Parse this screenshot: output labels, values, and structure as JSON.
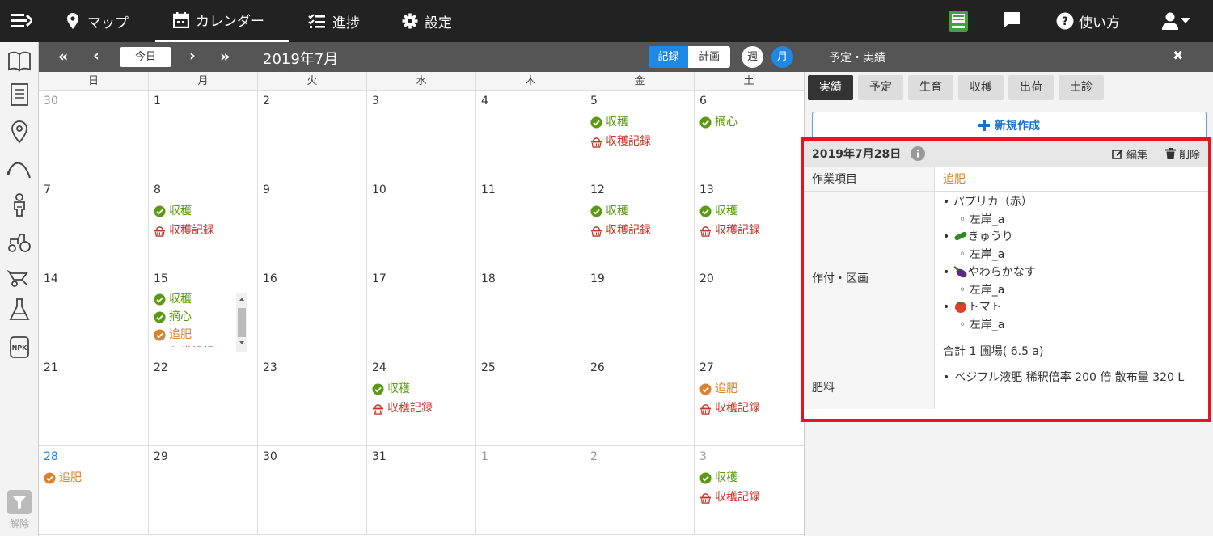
{
  "topbar": {
    "nav": [
      {
        "label": "マップ",
        "icon": "map-pin-icon"
      },
      {
        "label": "カレンダー",
        "icon": "calendar-icon"
      },
      {
        "label": "進捗",
        "icon": "checklist-icon"
      },
      {
        "label": "設定",
        "icon": "gear-icon"
      }
    ],
    "help_label": "使い方"
  },
  "subbar": {
    "today_label": "今日",
    "month_title": "2019年7月",
    "record_label": "記録",
    "plan_label": "計画",
    "week_label": "週",
    "month_label": "月",
    "panel_title": "予定・実績",
    "close_glyph": "✖"
  },
  "sidebar": {
    "filter_label": "解除"
  },
  "calendar": {
    "weekdays": [
      "日",
      "月",
      "火",
      "水",
      "木",
      "金",
      "土"
    ],
    "weeks": [
      [
        {
          "d": "30",
          "o": true,
          "e": []
        },
        {
          "d": "1",
          "e": []
        },
        {
          "d": "2",
          "e": []
        },
        {
          "d": "3",
          "e": []
        },
        {
          "d": "4",
          "e": []
        },
        {
          "d": "5",
          "e": [
            [
              "g",
              "収穫"
            ],
            [
              "r",
              "収穫記録"
            ]
          ]
        },
        {
          "d": "6",
          "e": [
            [
              "g",
              "摘心"
            ]
          ]
        }
      ],
      [
        {
          "d": "7",
          "e": []
        },
        {
          "d": "8",
          "e": [
            [
              "g",
              "収穫"
            ],
            [
              "r",
              "収穫記録"
            ]
          ]
        },
        {
          "d": "9",
          "e": []
        },
        {
          "d": "10",
          "e": []
        },
        {
          "d": "11",
          "e": []
        },
        {
          "d": "12",
          "e": [
            [
              "g",
              "収穫"
            ],
            [
              "r",
              "収穫記録"
            ]
          ]
        },
        {
          "d": "13",
          "e": [
            [
              "g",
              "収穫"
            ],
            [
              "r",
              "収穫記録"
            ]
          ]
        }
      ],
      [
        {
          "d": "14",
          "e": []
        },
        {
          "d": "15",
          "scroll": true,
          "e": [
            [
              "g",
              "収穫"
            ],
            [
              "g",
              "摘心"
            ],
            [
              "o",
              "追肥"
            ],
            [
              "r",
              "収穫記録"
            ]
          ]
        },
        {
          "d": "16",
          "e": []
        },
        {
          "d": "17",
          "e": []
        },
        {
          "d": "18",
          "e": []
        },
        {
          "d": "19",
          "e": []
        },
        {
          "d": "20",
          "e": []
        }
      ],
      [
        {
          "d": "21",
          "e": []
        },
        {
          "d": "22",
          "e": []
        },
        {
          "d": "23",
          "e": []
        },
        {
          "d": "24",
          "e": [
            [
              "g",
              "収穫"
            ],
            [
              "r",
              "収穫記録"
            ]
          ]
        },
        {
          "d": "25",
          "e": []
        },
        {
          "d": "26",
          "e": []
        },
        {
          "d": "27",
          "e": [
            [
              "o",
              "追肥"
            ],
            [
              "r",
              "収穫記録"
            ]
          ]
        }
      ],
      [
        {
          "d": "28",
          "t": true,
          "e": [
            [
              "o",
              "追肥"
            ]
          ]
        },
        {
          "d": "29",
          "e": []
        },
        {
          "d": "30",
          "e": []
        },
        {
          "d": "31",
          "e": []
        },
        {
          "d": "1",
          "o": true,
          "e": []
        },
        {
          "d": "2",
          "o": true,
          "e": []
        },
        {
          "d": "3",
          "o": true,
          "e": [
            [
              "g",
              "収穫"
            ],
            [
              "r",
              "収穫記録"
            ]
          ]
        }
      ]
    ]
  },
  "panel": {
    "tabs": [
      "実績",
      "予定",
      "生育",
      "収穫",
      "出荷",
      "土診"
    ],
    "new_label": "新規作成",
    "card": {
      "date": "2019年7月28日",
      "edit_label": "編集",
      "delete_label": "削除",
      "task_key": "作業項目",
      "task_value": "追肥",
      "crop_key": "作付・区画",
      "crops": [
        {
          "name": "パプリカ（赤）",
          "plot": "左岸_a",
          "icon": ""
        },
        {
          "name": "きゅうり",
          "plot": "左岸_a",
          "icon": "cucumber-icon"
        },
        {
          "name": "やわらかなす",
          "plot": "左岸_a",
          "icon": "eggplant-icon"
        },
        {
          "name": "トマト",
          "plot": "左岸_a",
          "icon": "tomato-icon"
        }
      ],
      "crop_total": "合計 1 圃場( 6.5 a)",
      "fert_key": "肥料",
      "fert_value": "ベジフル液肥 稀釈倍率 200 倍 散布量 320 L"
    }
  },
  "colors": {
    "green": "#5a9a12",
    "orange": "#d9822b",
    "red": "#c0392b",
    "blue": "#1e88e5",
    "highlight": "#e8141b"
  }
}
